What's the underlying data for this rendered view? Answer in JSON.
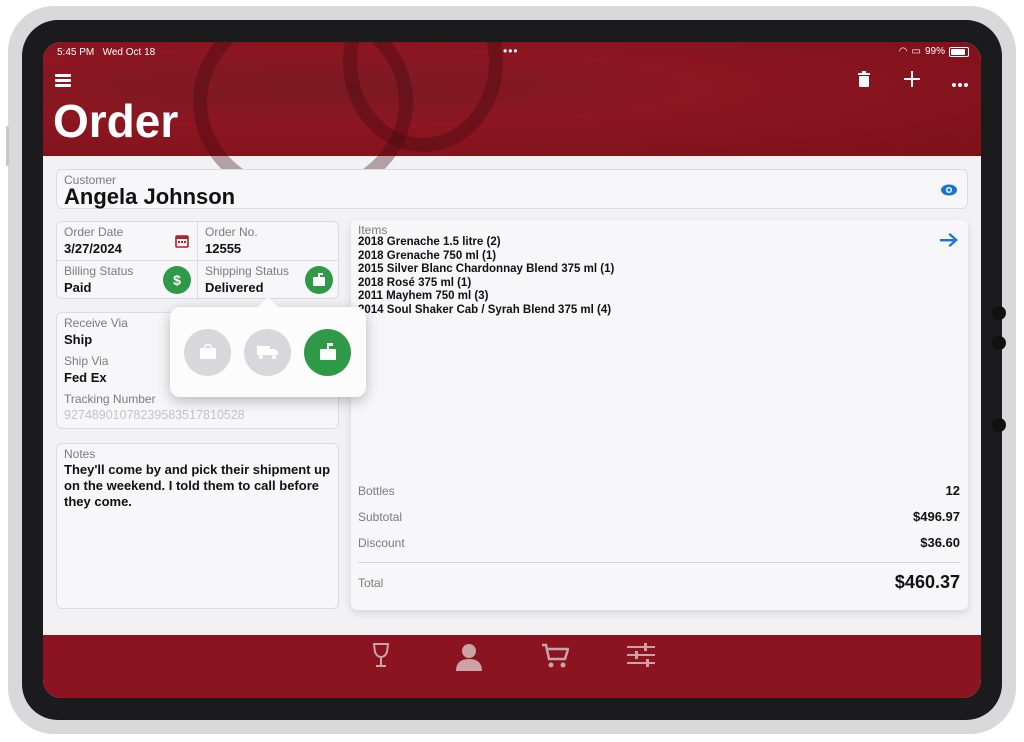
{
  "status": {
    "time": "5:45 PM",
    "date": "Wed Oct 18",
    "battery": "99%"
  },
  "header": {
    "title": "Order",
    "actions": [
      "trash-icon",
      "plus-icon",
      "more-icon"
    ]
  },
  "customer": {
    "label": "Customer",
    "name": "Angela Johnson"
  },
  "order_date": {
    "label": "Order Date",
    "value": "3/27/2024"
  },
  "order_no": {
    "label": "Order No.",
    "value": "12555"
  },
  "billing": {
    "label": "Billing Status",
    "value": "Paid"
  },
  "shipping": {
    "label": "Shipping Status",
    "value": "Delivered"
  },
  "receive_via": {
    "label": "Receive Via",
    "value": "Ship"
  },
  "ship_via": {
    "label": "Ship Via",
    "value": "Fed Ex"
  },
  "tracking": {
    "label": "Tracking Number",
    "placeholder": "92748901078239583517810528"
  },
  "notes": {
    "label": "Notes",
    "text": "They'll come by and pick their shipment up on the weekend. I told them to call before they come."
  },
  "items": {
    "label": "Items",
    "list": [
      "2018 Grenache 1.5 litre (2)",
      "2018 Grenache 750 ml (1)",
      "2015 Silver Blanc Chardonnay Blend 375 ml (1)",
      "2018 Rosé 375 ml (1)",
      "2011 Mayhem 750 ml (3)",
      "2014 Soul Shaker Cab / Syrah Blend 375 ml (4)"
    ]
  },
  "summary": {
    "bottles_label": "Bottles",
    "bottles": "12",
    "subtotal_label": "Subtotal",
    "subtotal": "$496.97",
    "discount_label": "Discount",
    "discount": "$36.60",
    "total_label": "Total",
    "total": "$460.37"
  },
  "shipping_options": [
    "package-icon",
    "truck-icon",
    "mailbox-icon"
  ],
  "tabs": [
    "wine-glass-icon",
    "person-icon",
    "cart-icon",
    "sliders-icon"
  ],
  "colors": {
    "brand": "#8b1420",
    "success": "#2e9a48",
    "link": "#1a73d6"
  }
}
